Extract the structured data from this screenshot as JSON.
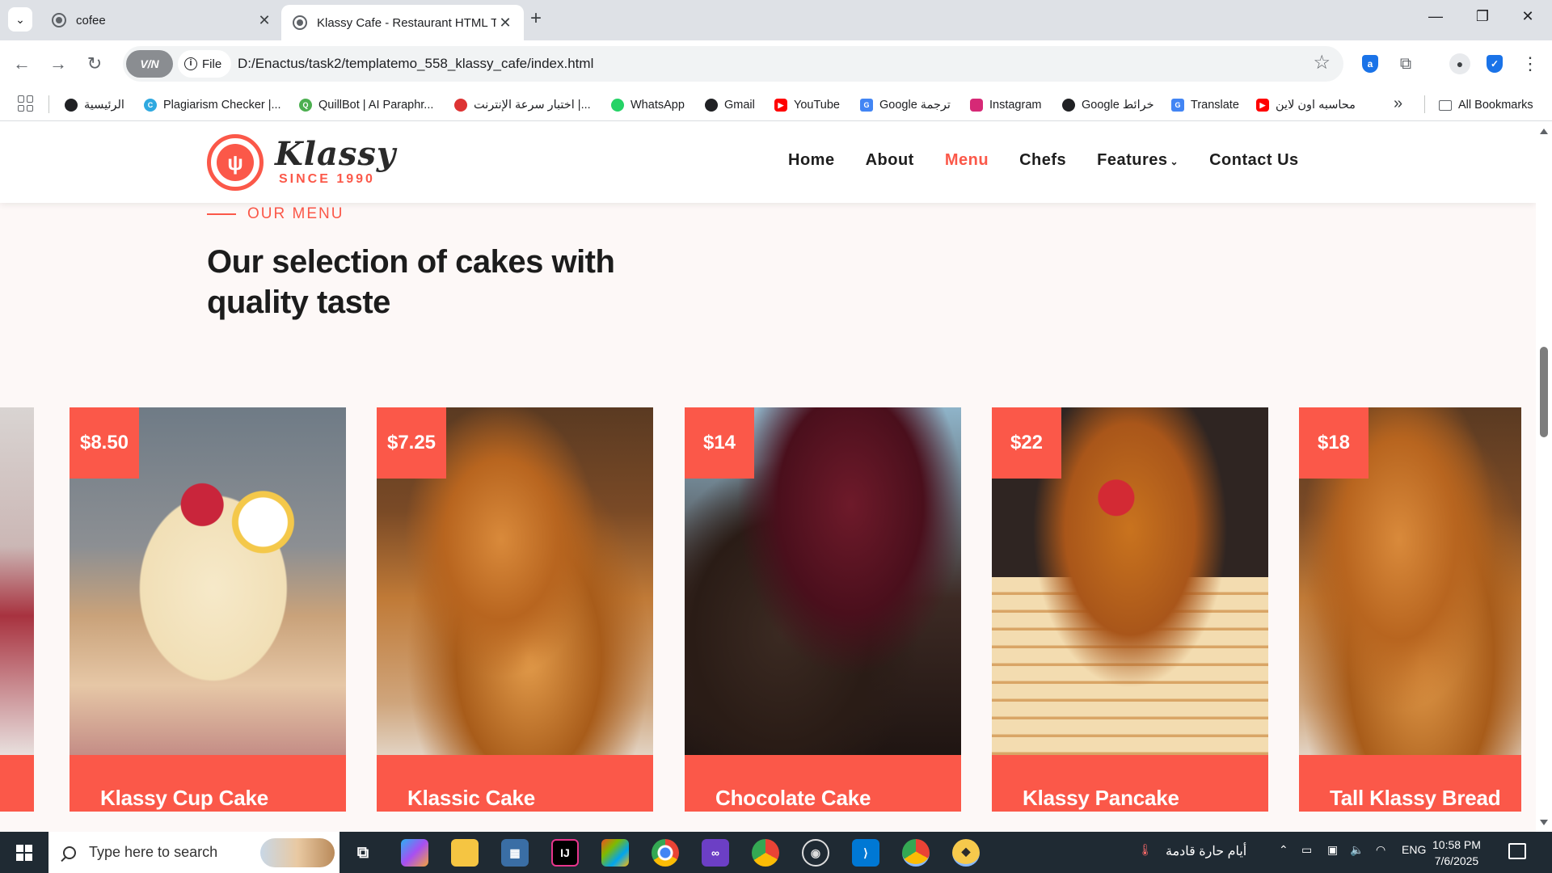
{
  "browser": {
    "tabs": [
      {
        "title": "cofee",
        "active": false
      },
      {
        "title": "Klassy Cafe - Restaurant HTML Template",
        "active": true
      }
    ],
    "new_tab": "+",
    "window_controls": {
      "minimize": "—",
      "restore": "❐",
      "close": "✕"
    },
    "omnibox": {
      "vpn_label": "V/N",
      "scheme_label": "File",
      "url": "D:/Enactus/task2/templatemo_558_klassy_cafe/index.html"
    },
    "bookmarks": [
      {
        "label": "الرئيسية",
        "icon": "globe-icon",
        "color": "#202124"
      },
      {
        "label": "Plagiarism Checker |...",
        "icon": "plagiarism-icon",
        "color": "#2fa9e0"
      },
      {
        "label": "QuillBot | AI Paraphr...",
        "icon": "quillbot-icon",
        "color": "#4caf50"
      },
      {
        "label": "اختبار سرعة الإنترنت |...",
        "icon": "speedtest-icon",
        "color": "#d33"
      },
      {
        "label": "WhatsApp",
        "icon": "whatsapp-icon",
        "color": "#25d366"
      },
      {
        "label": "Gmail",
        "icon": "globe-icon",
        "color": "#202124"
      },
      {
        "label": "YouTube",
        "icon": "youtube-icon",
        "color": "#ff0000"
      },
      {
        "label": "Google ترجمة",
        "icon": "translate-icon",
        "color": "#4285f4"
      },
      {
        "label": "Instagram",
        "icon": "instagram-icon",
        "color": "#d62976"
      },
      {
        "label": "Google خرائط",
        "icon": "globe-icon",
        "color": "#202124"
      },
      {
        "label": "Translate",
        "icon": "translate-icon",
        "color": "#4285f4"
      },
      {
        "label": "محاسبه اون لاين",
        "icon": "youtube-icon",
        "color": "#ff0000"
      }
    ],
    "bookmarks_more": "»",
    "all_bookmarks": "All Bookmarks"
  },
  "site": {
    "logo": {
      "name": "Klassy",
      "tagline": "SINCE 1990"
    },
    "nav": [
      {
        "label": "Home",
        "active": false
      },
      {
        "label": "About",
        "active": false
      },
      {
        "label": "Menu",
        "active": true
      },
      {
        "label": "Chefs",
        "active": false
      },
      {
        "label": "Features",
        "active": false,
        "dropdown": true
      },
      {
        "label": "Contact Us",
        "active": false
      }
    ],
    "section": {
      "eyebrow": "OUR MENU",
      "title": "Our selection of cakes with quality taste"
    },
    "cards": [
      {
        "price": "$8.50",
        "title": "Klassy Cup Cake"
      },
      {
        "price": "$7.25",
        "title": "Klassic Cake"
      },
      {
        "price": "$14",
        "title": "Chocolate Cake"
      },
      {
        "price": "$22",
        "title": "Klassy Pancake"
      },
      {
        "price": "$18",
        "title": "Tall Klassy Bread"
      }
    ],
    "accent_color": "#fb5849"
  },
  "taskbar": {
    "search_placeholder": "Type here to search",
    "weather": "أيام حارة قادمة",
    "language": "ENG",
    "time": "10:58 PM",
    "date": "7/6/2025"
  }
}
